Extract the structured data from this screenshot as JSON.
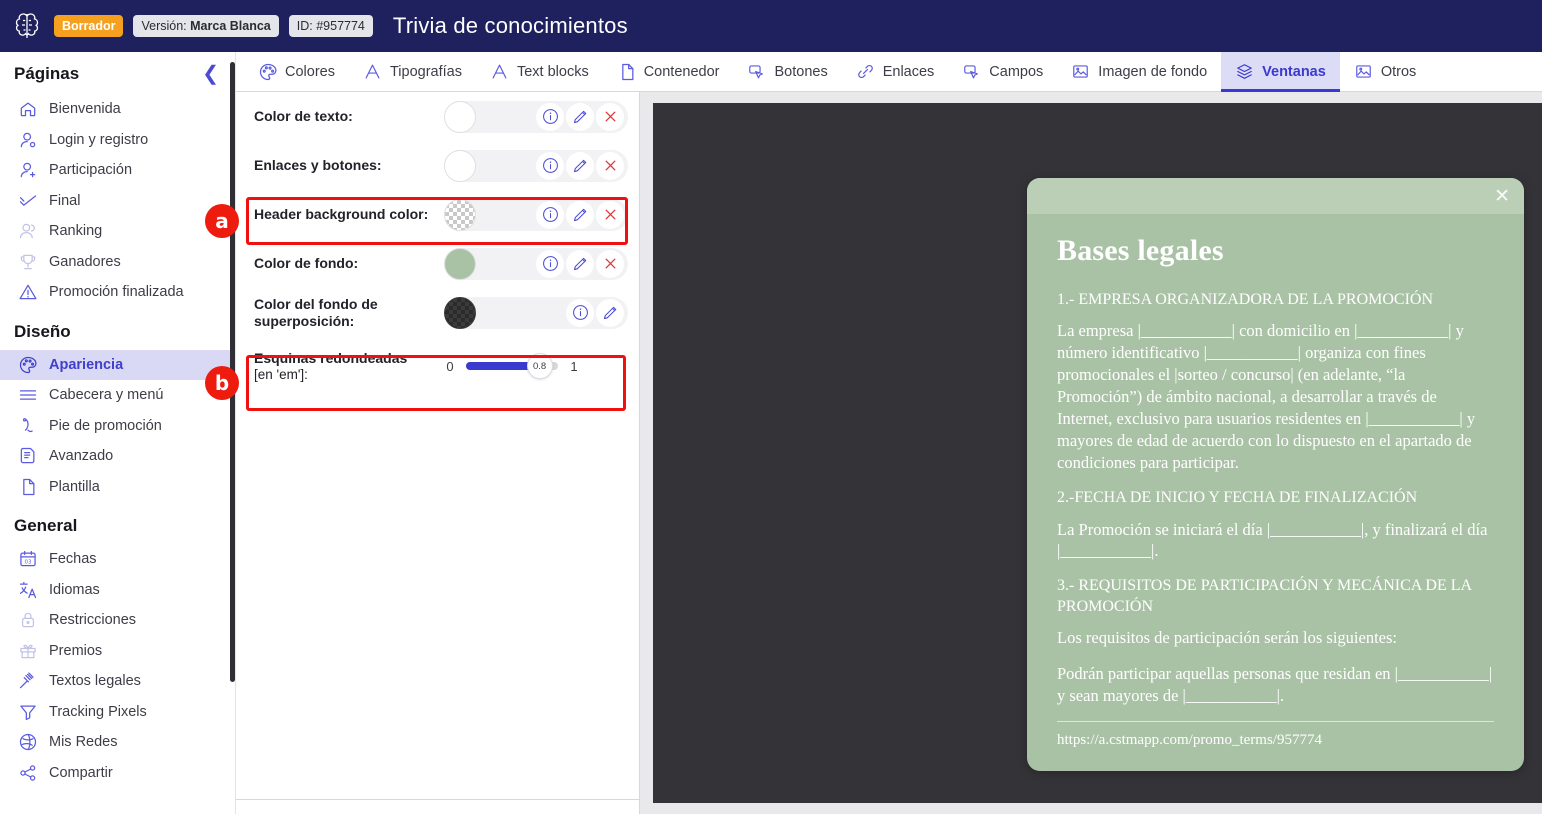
{
  "topbar": {
    "logo_icon": "brain-logo-icon",
    "status_badge": "Borrador",
    "version_label": "Versión:",
    "version_value": "Marca Blanca",
    "id_label": "ID:",
    "id_value": "#957774",
    "title": "Trivia de conocimientos"
  },
  "sidebar": {
    "header": "Páginas",
    "collapse_icon": "chevron-left-icon",
    "pages": [
      {
        "label": "Bienvenida",
        "icon": "home-icon",
        "active": false,
        "dim": false
      },
      {
        "label": "Login y registro",
        "icon": "user-login-icon",
        "active": false,
        "dim": false
      },
      {
        "label": "Participación",
        "icon": "user-add-icon",
        "active": false,
        "dim": false
      },
      {
        "label": "Final",
        "icon": "check-icon",
        "active": false,
        "dim": false
      },
      {
        "label": "Ranking",
        "icon": "users-icon",
        "active": false,
        "dim": true
      },
      {
        "label": "Ganadores",
        "icon": "trophy-icon",
        "active": false,
        "dim": true
      },
      {
        "label": "Promoción finalizada",
        "icon": "warning-triangle-icon",
        "active": false,
        "dim": false
      }
    ],
    "design_title": "Diseño",
    "design": [
      {
        "label": "Apariencia",
        "icon": "palette-icon",
        "active": true,
        "dim": false
      },
      {
        "label": "Cabecera y menú",
        "icon": "menu-lines-icon",
        "active": false,
        "dim": false
      },
      {
        "label": "Pie de promoción",
        "icon": "footer-icon",
        "active": false,
        "dim": false
      },
      {
        "label": "Avanzado",
        "icon": "document-code-icon",
        "active": false,
        "dim": false
      },
      {
        "label": "Plantilla",
        "icon": "file-icon",
        "active": false,
        "dim": false
      }
    ],
    "general_title": "General",
    "general": [
      {
        "label": "Fechas",
        "icon": "calendar-icon",
        "active": false,
        "dim": false
      },
      {
        "label": "Idiomas",
        "icon": "translate-icon",
        "active": false,
        "dim": false
      },
      {
        "label": "Restricciones",
        "icon": "lock-icon",
        "active": false,
        "dim": true
      },
      {
        "label": "Premios",
        "icon": "gift-icon",
        "active": false,
        "dim": true
      },
      {
        "label": "Textos legales",
        "icon": "gavel-icon",
        "active": false,
        "dim": false
      },
      {
        "label": "Tracking Pixels",
        "icon": "funnel-icon",
        "active": false,
        "dim": false
      },
      {
        "label": "Mis Redes",
        "icon": "globe-icon",
        "active": false,
        "dim": false
      },
      {
        "label": "Compartir",
        "icon": "share-icon",
        "active": false,
        "dim": false
      }
    ]
  },
  "tabs": [
    {
      "label": "Colores",
      "icon": "palette-icon",
      "active": false
    },
    {
      "label": "Tipografías",
      "icon": "typography-icon",
      "active": false
    },
    {
      "label": "Text blocks",
      "icon": "typography-icon",
      "active": false
    },
    {
      "label": "Contenedor",
      "icon": "file-icon",
      "active": false
    },
    {
      "label": "Botones",
      "icon": "button-icon",
      "active": false
    },
    {
      "label": "Enlaces",
      "icon": "link-icon",
      "active": false
    },
    {
      "label": "Campos",
      "icon": "button-icon",
      "active": false
    },
    {
      "label": "Imagen de fondo",
      "icon": "image-icon",
      "active": false
    },
    {
      "label": "Ventanas",
      "icon": "layers-icon",
      "active": true
    },
    {
      "label": "Otros",
      "icon": "image-icon",
      "active": false
    }
  ],
  "settings": {
    "rows": [
      {
        "label": "Color de texto:",
        "sub": "",
        "swatch_kind": "solid",
        "swatch_color": "#ffffff",
        "buttons": [
          "info-icon",
          "edit-pencil-icon",
          "clear-x-icon"
        ]
      },
      {
        "label": "Enlaces y botones:",
        "sub": "",
        "swatch_kind": "solid",
        "swatch_color": "#ffffff",
        "buttons": [
          "info-icon",
          "edit-pencil-icon",
          "clear-x-icon"
        ]
      },
      {
        "label": "Header background color:",
        "sub": "",
        "swatch_kind": "transparent",
        "swatch_color": "transparent",
        "buttons": [
          "info-icon",
          "edit-pencil-icon",
          "clear-x-icon"
        ]
      },
      {
        "label": "Color de fondo:",
        "sub": "",
        "swatch_kind": "solid",
        "swatch_color": "#a9c2a5",
        "buttons": [
          "info-icon",
          "edit-pencil-icon",
          "clear-x-icon"
        ]
      },
      {
        "label": "Color del fondo de superposición:",
        "sub": "",
        "swatch_kind": "transparent-dark",
        "swatch_color": "#3b3b3b",
        "buttons": [
          "info-icon",
          "edit-pencil-icon"
        ]
      }
    ],
    "slider": {
      "label": "Esquinas redondeadas",
      "sub": "[en 'em']:",
      "min": "0",
      "max": "1",
      "value": "0.8",
      "percent": 80
    }
  },
  "preview": {
    "modal": {
      "close_icon": "close-x-icon",
      "title": "Bases legales",
      "blocks": [
        {
          "kind": "heading",
          "text": "1.- EMPRESA ORGANIZADORA DE LA PROMOCIÓN"
        },
        {
          "kind": "para",
          "text": "La empresa |___________| con domicilio en |___________| y número identificativo |___________| organiza con fines promocionales el |sorteo / concurso| (en adelante, “la Promoción”) de ámbito nacional, a desarrollar a través de Internet, exclusivo para usuarios residentes en |___________| y mayores de edad de acuerdo con lo dispuesto en el apartado de condiciones para participar."
        },
        {
          "kind": "heading",
          "text": "2.-FECHA DE INICIO Y FECHA DE FINALIZACIÓN"
        },
        {
          "kind": "para",
          "text": "La Promoción se iniciará el día |___________|, y finalizará el día |___________|."
        },
        {
          "kind": "heading",
          "text": "3.- REQUISITOS DE PARTICIPACIÓN Y MECÁNICA DE LA PROMOCIÓN"
        },
        {
          "kind": "para",
          "text": "Los requisitos de participación serán los siguientes:"
        },
        {
          "kind": "para",
          "text": "Podrán participar aquellas personas que residan en |___________| y sean mayores de |___________|."
        }
      ],
      "url": "https://a.cstmapp.com/promo_terms/957774"
    }
  },
  "annotations": {
    "badge_a": "a",
    "badge_b": "b",
    "accent_red": "#ee1b0f"
  }
}
